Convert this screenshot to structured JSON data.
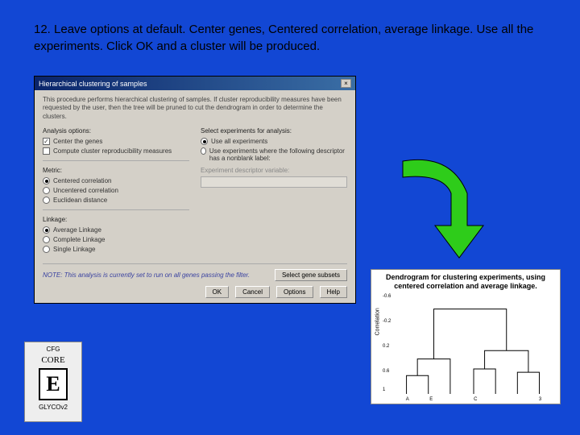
{
  "instruction": "12.  Leave options at default.  Center genes, Centered correlation, average linkage.  Use all the experiments.  Click OK and a cluster will be produced.",
  "dialog": {
    "title": "Hierarchical clustering of samples",
    "desc": "This procedure performs hierarchical clustering of samples. If cluster reproducibility measures have been requested by the user, then the tree will be pruned to cut the dendrogram in order to determine the clusters.",
    "analysis_label": "Analysis options:",
    "center_genes": "Center the genes",
    "compute_repro": "Compute cluster reproducibility measures",
    "metric_label": "Metric:",
    "centered_corr": "Centered correlation",
    "uncentered_corr": "Uncentered correlation",
    "euclidean": "Euclidean distance",
    "linkage_label": "Linkage:",
    "avg_linkage": "Average Linkage",
    "complete_linkage": "Complete Linkage",
    "single_linkage": "Single Linkage",
    "select_exp_label": "Select experiments for analysis:",
    "use_all": "Use all experiments",
    "use_where": "Use experiments where the following descriptor has a nonblank label:",
    "exp_desc_label": "Experiment descriptor variable:",
    "note": "NOTE: This analysis is currently set to run on all genes passing the filter.",
    "select_subsets": "Select gene subsets",
    "ok": "OK",
    "cancel": "Cancel",
    "options": "Options",
    "help": "Help"
  },
  "chart_data": {
    "type": "dendrogram",
    "title": "Dendrogram for clustering experiments, using centered correlation and average linkage.",
    "ylabel": "Correlation",
    "yticks": [
      "1",
      "0.6",
      "0.2",
      "-0.2",
      "-0.6"
    ],
    "labels": [
      "A",
      "E",
      "",
      "C",
      "",
      "",
      "3"
    ],
    "merges": [
      {
        "left": 0,
        "right": 1,
        "height": 0.7
      },
      {
        "left": 3,
        "right": 4,
        "height": 0.55
      },
      {
        "left": 5,
        "right": 6,
        "height": 0.6
      },
      {
        "left": "m0",
        "right": 2,
        "height": 0.3
      },
      {
        "left": "m1",
        "right": "m2",
        "height": 0.1
      },
      {
        "left": "m3",
        "right": "m4",
        "height": -0.5
      }
    ]
  },
  "logo": {
    "top": "CFG",
    "core": "CORE",
    "letter": "E",
    "bottom": "GLYCOv2"
  }
}
